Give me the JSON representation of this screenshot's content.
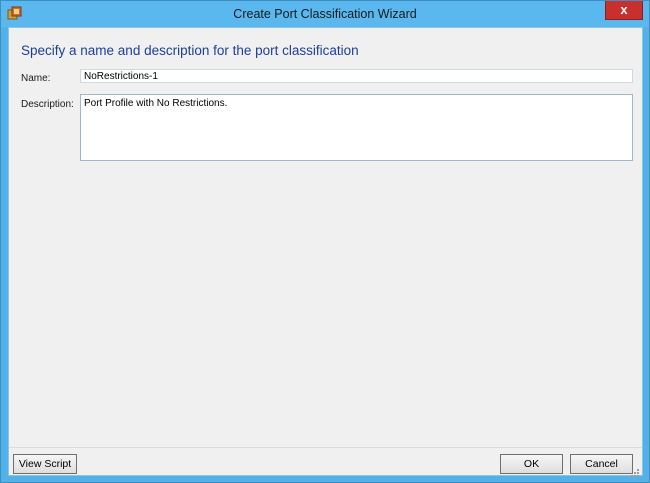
{
  "window": {
    "title": "Create Port Classification Wizard",
    "close_glyph": "x"
  },
  "page": {
    "heading": "Specify a name and description for the port classification"
  },
  "form": {
    "name_label": "Name:",
    "name_value": "NoRestrictions-1",
    "description_label": "Description:",
    "description_value": "Port Profile with No Restrictions."
  },
  "footer": {
    "view_script_label": "View Script",
    "ok_label": "OK",
    "cancel_label": "Cancel"
  },
  "icons": {
    "app": "vmm-app-icon",
    "close": "close-icon",
    "grip": "resize-grip-icon"
  },
  "colors": {
    "titlebar": "#5ab8ee",
    "heading": "#1d3f99",
    "close": "#c7302c"
  }
}
